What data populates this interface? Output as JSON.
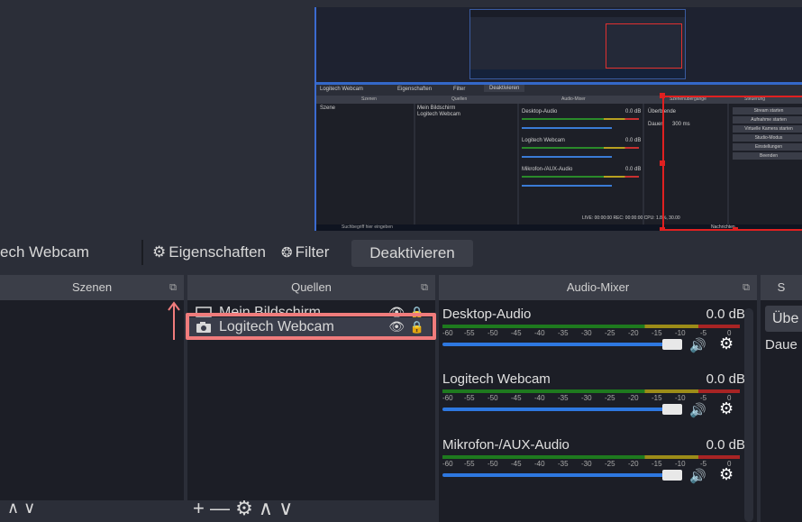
{
  "preview": {
    "toolbar": {
      "source": "Logitech Webcam",
      "properties": "Eigenschaften",
      "filter": "Filter",
      "deactivate": "Deaktivieren"
    },
    "headers": [
      "Szenen",
      "Quellen",
      "Audio-Mixer",
      "Szenenübergänge",
      "Steuerung"
    ],
    "scene": "Szene",
    "sources": [
      "Mein Bildschirm",
      "Logitech Webcam"
    ],
    "mixer": [
      {
        "name": "Desktop-Audio",
        "db": "0.0 dB"
      },
      {
        "name": "Logitech Webcam",
        "db": "0.0 dB"
      },
      {
        "name": "Mikrofon-/AUX-Audio",
        "db": "0.0 dB"
      }
    ],
    "transition": "Überblende",
    "duration_label": "Dauer",
    "duration_value": "300 ms",
    "controls": [
      "Stream starten",
      "Aufnahme starten",
      "Virtuelle Kamera starten",
      "Studio-Modus",
      "Einstellungen",
      "Beenden"
    ],
    "status": "LIVE: 00:00:00   REC: 00:00:00   CPU: 1.8%, 30.00",
    "taskbar_search": "Suchbegriff hier eingeben",
    "taskbar_news": "Nachrichten"
  },
  "toolbar": {
    "source_label": "ech Webcam",
    "properties_label": "Eigenschaften",
    "filter_label": "Filter",
    "deactivate_label": "Deaktivieren"
  },
  "docks": {
    "scenes": {
      "title": "Szenen"
    },
    "sources": {
      "title": "Quellen",
      "items": [
        {
          "label": "Mein Bildschirm",
          "icon": "monitor-icon"
        },
        {
          "label": "Logitech Webcam",
          "icon": "camera-icon"
        }
      ]
    },
    "mixer": {
      "title": "Audio-Mixer",
      "ticks": [
        "-60",
        "-55",
        "-50",
        "-45",
        "-40",
        "-35",
        "-30",
        "-25",
        "-20",
        "-15",
        "-10",
        "-5",
        "0"
      ],
      "channels": [
        {
          "name": "Desktop-Audio",
          "db": "0.0 dB"
        },
        {
          "name": "Logitech Webcam",
          "db": "0.0 dB"
        },
        {
          "name": "Mikrofon-/AUX-Audio",
          "db": "0.0 dB"
        }
      ]
    },
    "transitions": {
      "title": "S",
      "current": "Übe",
      "duration_label": "Daue"
    }
  },
  "footer": {
    "scenes_controls": "∧ ∨",
    "sources_controls": "+ — ⚙  ∧ ∨"
  },
  "colors": {
    "background": "#2b2e38",
    "dock_body": "#1c1e26",
    "highlight": "#f07c7c",
    "fader": "#2e78e0"
  }
}
